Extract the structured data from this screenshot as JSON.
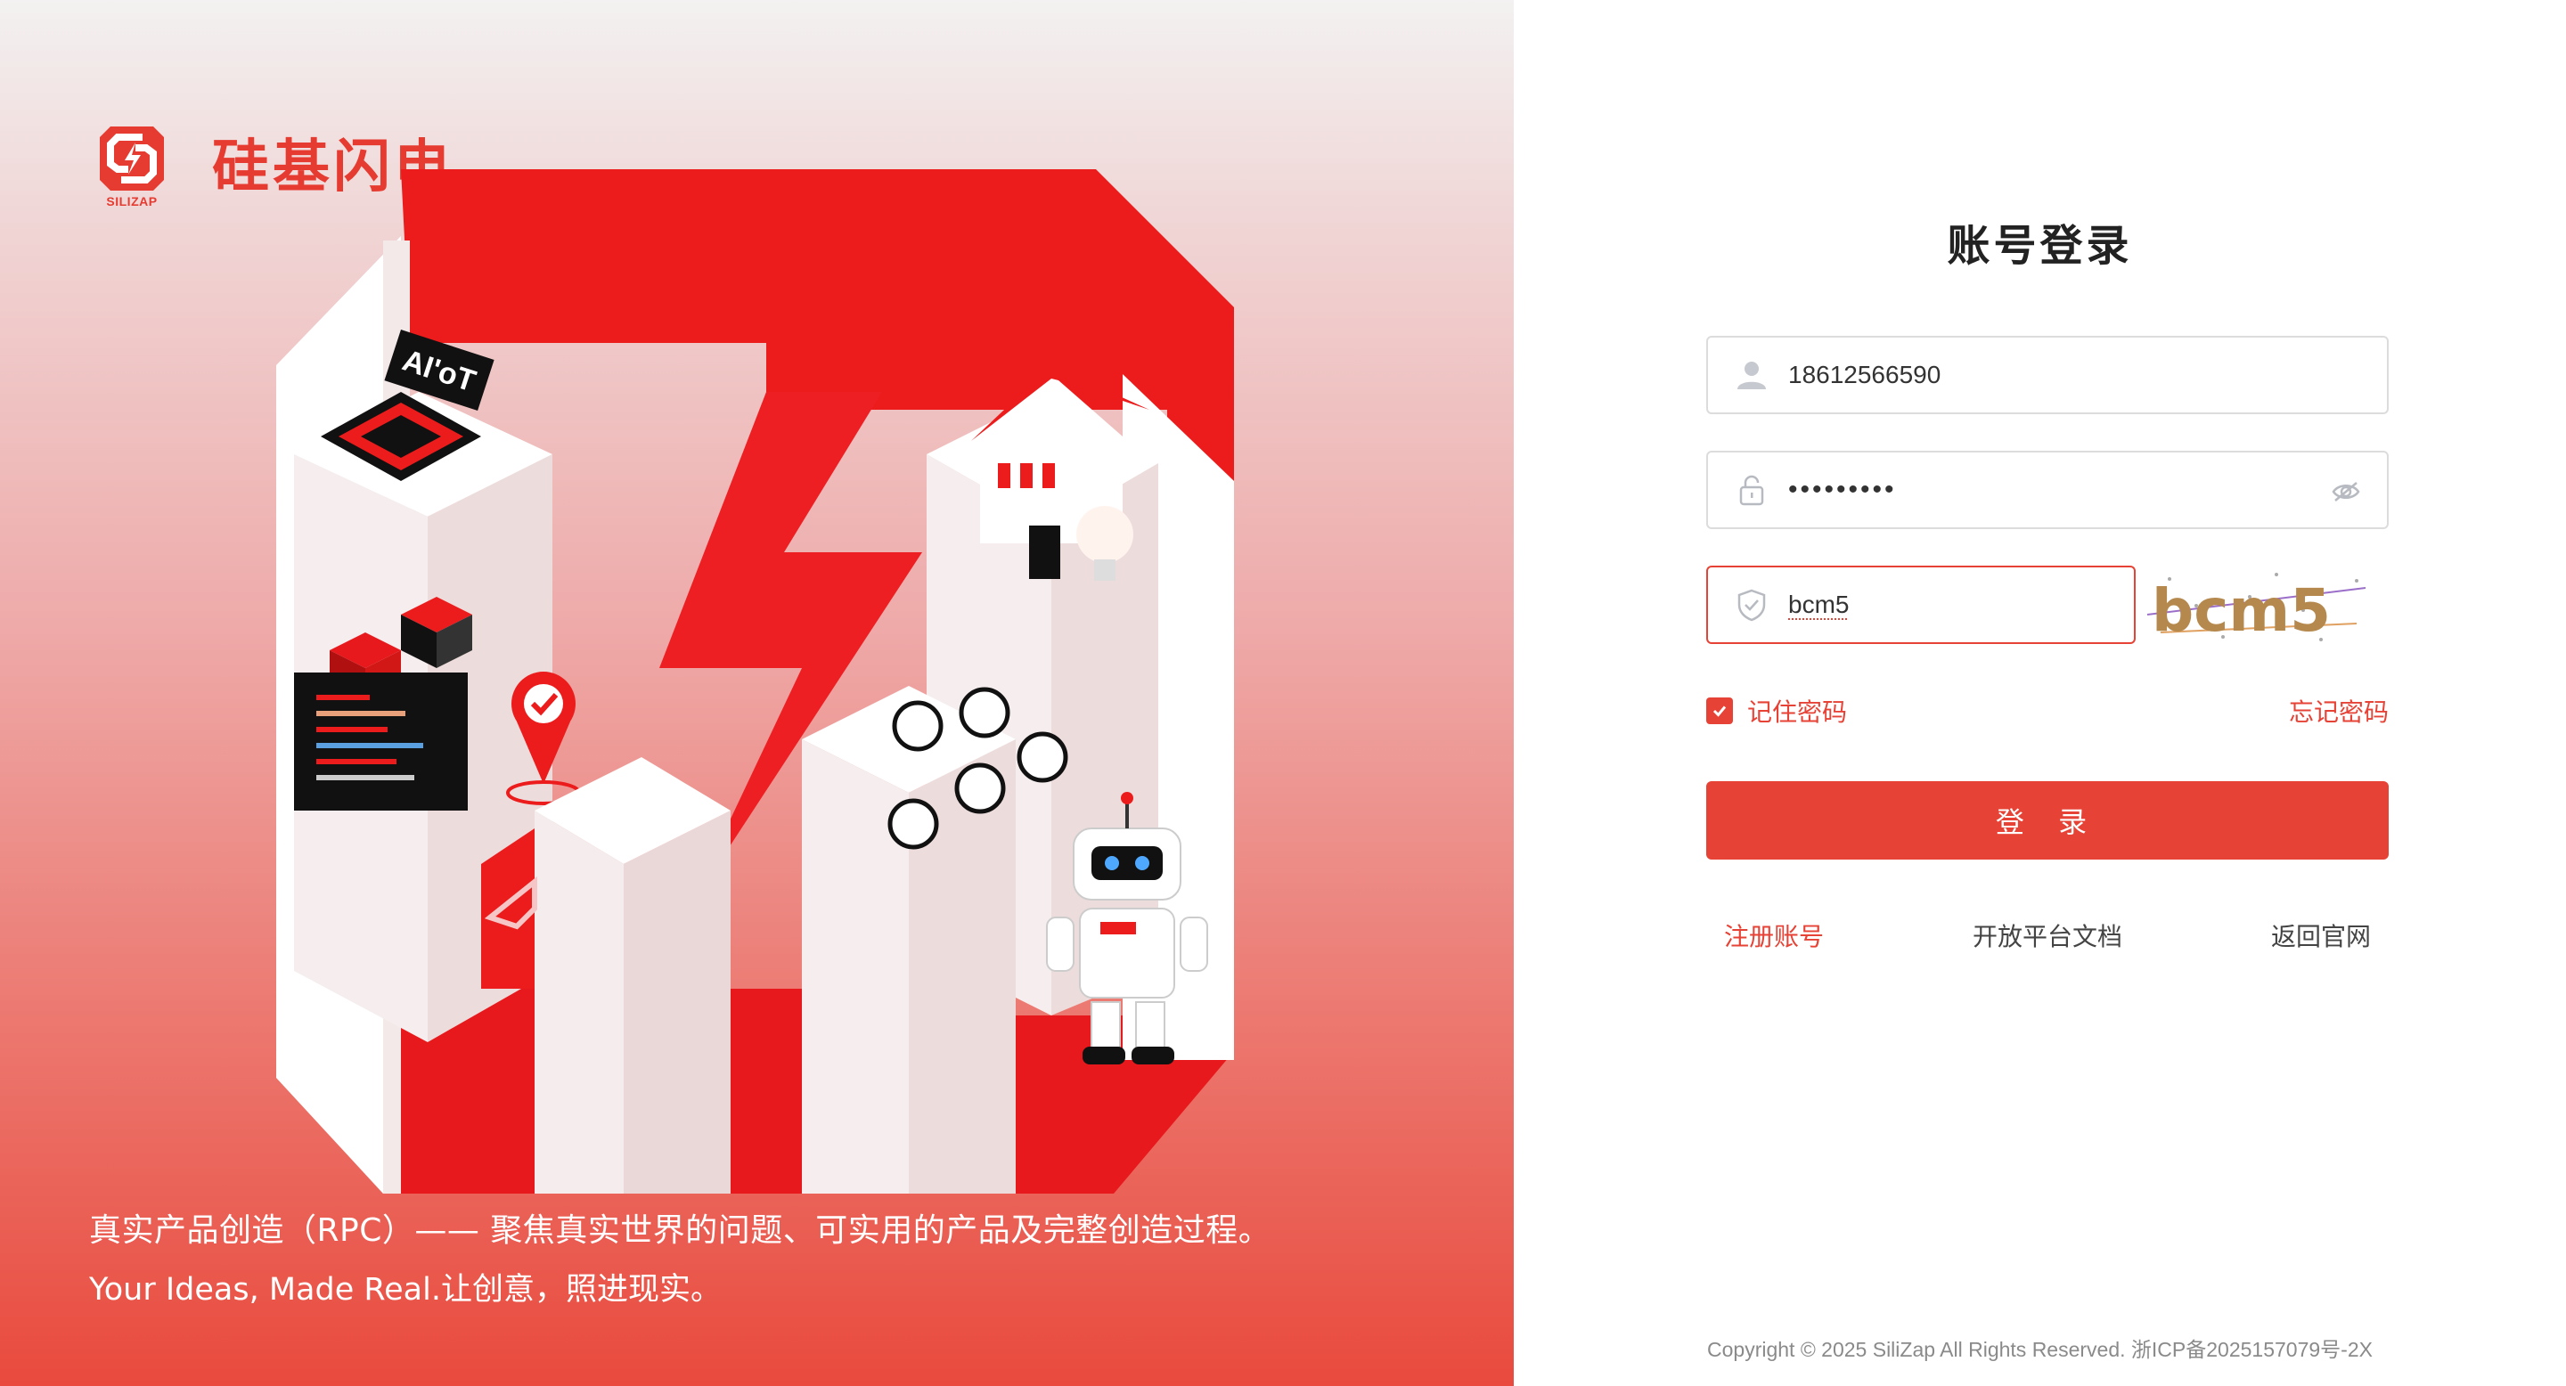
{
  "brand": {
    "name": "硅基闪电",
    "logo_text": "SILIZAP"
  },
  "hero": {
    "illustration_labels": {
      "aiot_sign": "AI'oT"
    },
    "tagline_line1": "真实产品创造（RPC）—— 聚焦真实世界的问题、可实用的产品及完整创造过程。",
    "tagline_line2": "Your Ideas, Made Real.让创意，照进现实。"
  },
  "login": {
    "title": "账号登录",
    "username": {
      "value": "18612566590",
      "icon": "user-icon"
    },
    "password": {
      "value": "•••••••••",
      "icon": "lock-icon",
      "toggle_icon": "eye-off-icon"
    },
    "captcha": {
      "value": "bcm5",
      "icon": "shield-check-icon",
      "image_text": "bcm5"
    },
    "remember_label": "记住密码",
    "remember_checked": true,
    "forgot_label": "忘记密码",
    "submit_label": "登 录",
    "links": {
      "register": "注册账号",
      "docs": "开放平台文档",
      "home": "返回官网"
    }
  },
  "footer": {
    "copyright": "Copyright © 2025 SiliZap All Rights Reserved. 浙ICP备2025157079号-2X"
  },
  "colors": {
    "accent": "#e64235",
    "hero_top": "#f3f1f1",
    "hero_bottom": "#e94a3d"
  }
}
